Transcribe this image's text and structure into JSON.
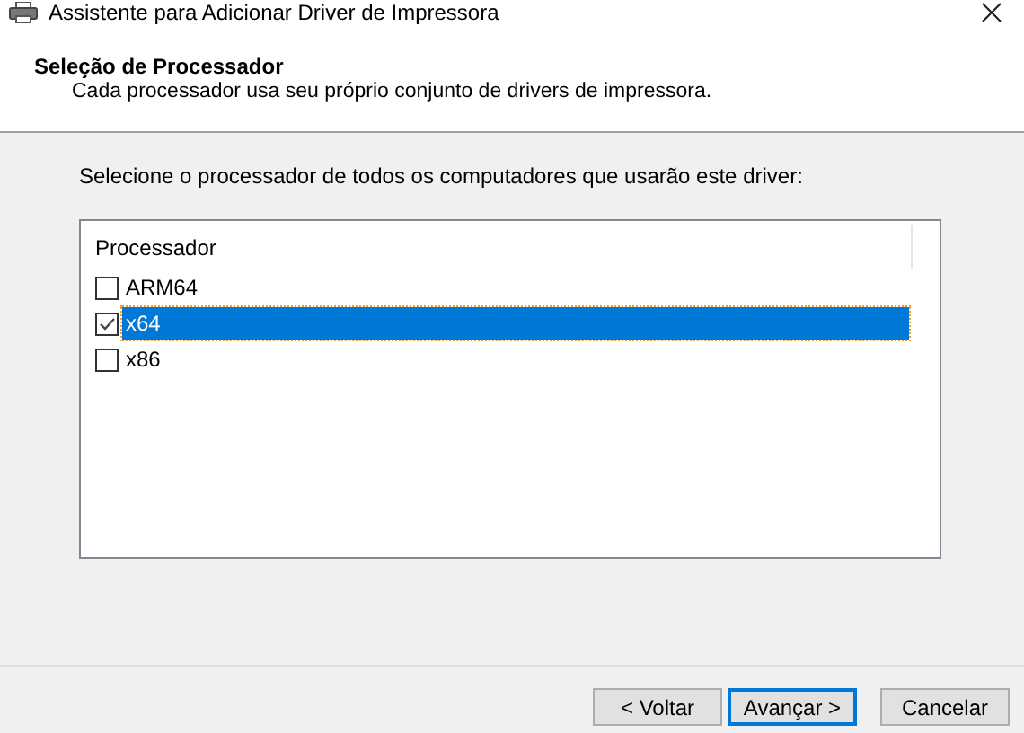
{
  "window": {
    "title": "Assistente para Adicionar Driver de Impressora"
  },
  "header": {
    "title": "Seleção de Processador",
    "subtitle": "Cada processador usa seu próprio conjunto de drivers de impressora."
  },
  "instruction": "Selecione o processador de todos os computadores que usarão este driver:",
  "list": {
    "columns": [
      "Processador"
    ],
    "rows": [
      {
        "label": "ARM64",
        "checked": false,
        "selected": false
      },
      {
        "label": "x64",
        "checked": true,
        "selected": true
      },
      {
        "label": "x86",
        "checked": false,
        "selected": false
      }
    ]
  },
  "buttons": [
    {
      "label": "< Voltar",
      "default": false
    },
    {
      "label": "Avançar >",
      "default": true
    },
    {
      "label": "Cancelar",
      "default": false
    }
  ]
}
